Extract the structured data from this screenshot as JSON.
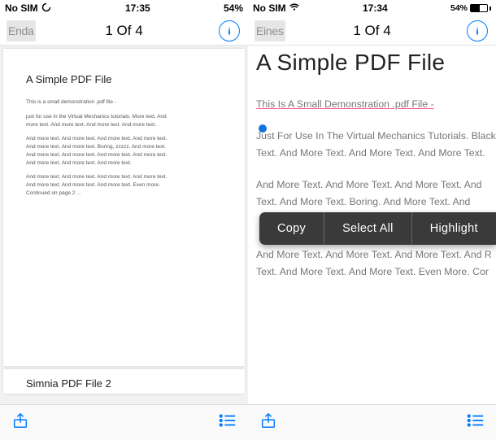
{
  "left_screen": {
    "status": {
      "carrier": "No SIM",
      "time": "17:35",
      "battery_pct": "54%"
    },
    "navbar": {
      "back": "Enda",
      "page_indicator": "1 Of 4"
    },
    "page1": {
      "title": "A Simple PDF File",
      "para1": "This is a small demonstration .pdf file -",
      "para2": "just for use in the Virtual Mechanics tutorials. More text. And more text. And more text. And more text. And more text.",
      "para3": "And more text. And more text. And more text. And more text. And more text. And more text. Boring, zzzzz. And more text. And more text. And more text. And more text. And more text. And more text. And more text. And more text.",
      "para4": "And more text. And more text. And more text. And more text. And more text. And more text. And more text. Even more. Continued on page 2 ..."
    },
    "page2": {
      "title": "Simnia PDF File 2"
    }
  },
  "right_screen": {
    "status": {
      "carrier": "No SIM",
      "time": "17:34",
      "battery_pct": "54%"
    },
    "navbar": {
      "back": "Eines",
      "page_indicator": "1 Of 4"
    },
    "zoom": {
      "title": "A Simple PDF File",
      "p1": "This Is A Small Demonstration .pdf File -",
      "p2a": "Just For Use In The Virtual Mechanics Tutorials. BlackBerry",
      "p2b": "Text. And More Text. And More Text. And More Text.",
      "p3a": "And More Text. And More Text. And More Text. And",
      "p3b": "Text. And More Text. Boring. And More Text. And",
      "p4a": "And More Text. And More Text. And More Text. And R",
      "p4b": "Text. And More Text. And More Text. Even More. Cor"
    },
    "context_menu": {
      "copy": "Copy",
      "select_all": "Select All",
      "highlight": "Highlight"
    }
  }
}
